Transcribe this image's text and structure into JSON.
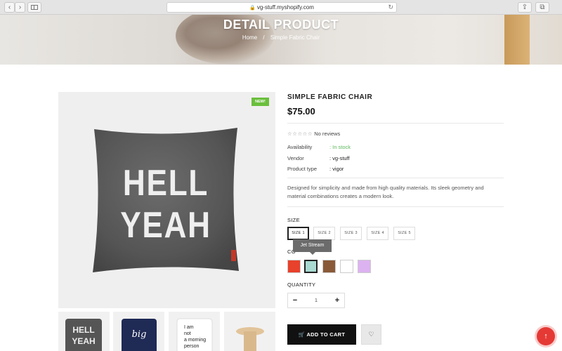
{
  "browser": {
    "url": "vg-stuff.myshopify.com"
  },
  "hero": {
    "title": "DETAIL PRODUCT",
    "breadcrumb": {
      "home": "Home",
      "separator": "/",
      "current": "Simple Fabric Chair"
    }
  },
  "product": {
    "badge": "NEW!",
    "title": "SIMPLE FABRIC CHAIR",
    "price": "$75.00",
    "stars": "☆☆☆☆☆",
    "reviews": "No reviews",
    "attributes": [
      {
        "label": "Availability",
        "value": ": In stock"
      },
      {
        "label": "Vendor",
        "value": ": vg-stuff"
      },
      {
        "label": "Product type",
        "value": ": vigor"
      }
    ],
    "description": "Designed for simplicity and made from high quality materials. Its sleek geometry and material combinations creates a modern look.",
    "image_text": {
      "line1": "HELL",
      "line2": "YEAH"
    }
  },
  "options": {
    "size_label": "SIZE",
    "sizes": [
      "SIZE 1",
      "SIZE 2",
      "SIZE 3",
      "SIZE 4",
      "SIZE 5"
    ],
    "selected_size": "SIZE 1",
    "color_label": "CO",
    "colors": [
      "#e8412c",
      "#a9d9d1",
      "#8a5a38",
      "#ffffff",
      "#dcb2f0"
    ],
    "selected_color_tooltip": "Jet Stream",
    "quantity_label": "QUANTITY",
    "quantity": "1",
    "minus": "−",
    "plus": "+"
  },
  "actions": {
    "add_to_cart": "ADD TO CART",
    "wishlist_icon": "heart-icon",
    "back_to_top_icon": "arrow-up-icon"
  },
  "thumbnails": {
    "t1": {
      "line1": "HELL",
      "line2": "YEAH"
    },
    "t2": {
      "line1": "big",
      "line2": ""
    },
    "t3": {
      "line1": "I am",
      "line2": "not",
      "line3": "a morning",
      "line4": "person"
    }
  }
}
